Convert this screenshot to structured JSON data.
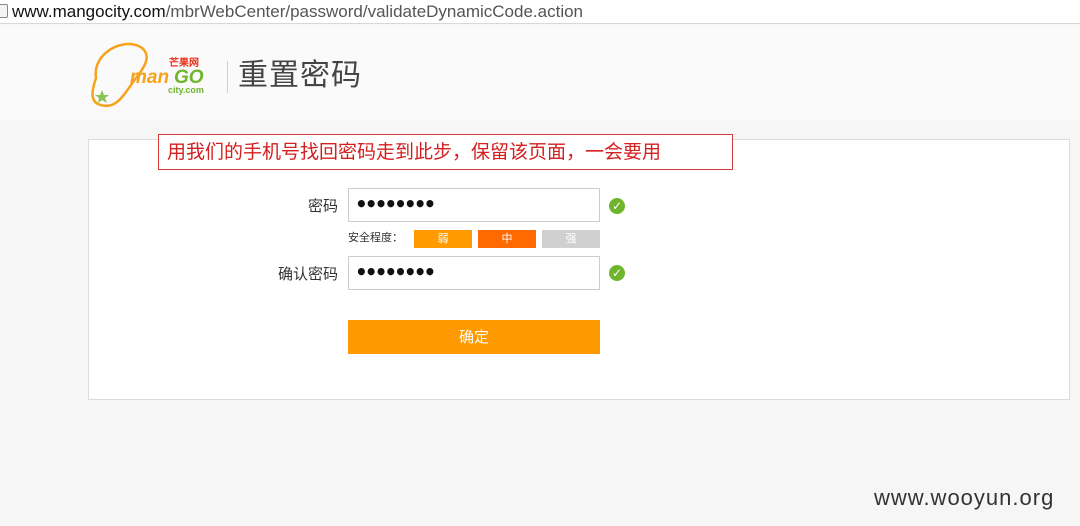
{
  "browser": {
    "url_host": "www.mangocity.com",
    "url_path": "/mbrWebCenter/password/validateDynamicCode.action"
  },
  "logo": {
    "cn_text": "芒果网",
    "brand_text_1": "man",
    "brand_text_2": "GO",
    "domain_text": "city.com",
    "orange": "#f7a21b",
    "green": "#6fb52c",
    "red": "#e8341c"
  },
  "header": {
    "page_title": "重置密码"
  },
  "annotation": {
    "text": "用我们的手机号找回密码走到此步，保留该页面，一会要用"
  },
  "form": {
    "password_label": "密码",
    "password_value": "••••••••",
    "confirm_label": "确认密码",
    "confirm_value": "••••••••",
    "strength_label": "安全程度：",
    "strength_weak": "弱",
    "strength_mid": "中",
    "strength_strong": "强",
    "check_glyph": "✓",
    "submit_label": "确定"
  },
  "colors": {
    "accent": "#ff9900",
    "strength_mid": "#ff6a00",
    "annotation_red": "#d42020",
    "valid_green": "#6fb52c"
  },
  "watermark": "www.wooyun.org"
}
